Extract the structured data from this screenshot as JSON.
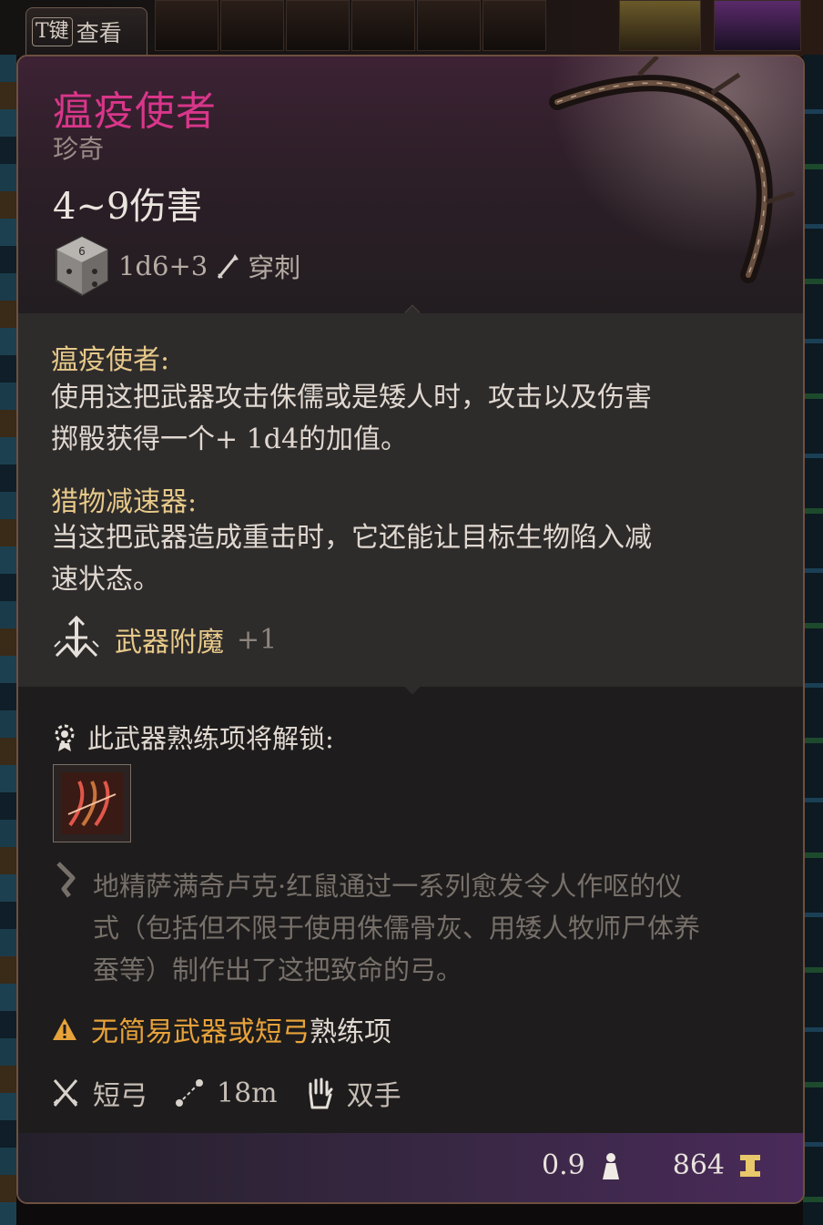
{
  "hotkey": {
    "key": "T键",
    "label": "查看"
  },
  "item": {
    "name": "瘟疫使者",
    "rarity": "珍奇",
    "damage": "4~9伤害",
    "dice": "1d6+3",
    "damage_type": "穿刺"
  },
  "passives": [
    {
      "title": "瘟疫使者:",
      "lines": [
        "使用这把武器攻击侏儒或是矮人时，攻击以及伤害",
        "掷骰获得一个+ 1d4的加值。"
      ]
    },
    {
      "title": "猎物减速器:",
      "lines": [
        "当这把武器造成重击时，它还能让目标生物陷入减",
        "速状态。"
      ]
    }
  ],
  "enchant": {
    "label": "武器附魔",
    "value": "+1"
  },
  "proficiency": {
    "label": "此武器熟练项将解锁:"
  },
  "lore": [
    "地精萨满奇卢克·红鼠通过一系列愈发令人作呕的仪",
    "式（包括但不限于使用侏儒骨灰、用矮人牧师尸体养",
    "蚕等）制作出了这把致命的弓。"
  ],
  "warning": {
    "highlight": "无简易武器或短弓",
    "rest": "熟练项"
  },
  "stats": {
    "weapon_type": "短弓",
    "range": "18m",
    "hands": "双手"
  },
  "footer": {
    "weight": "0.9",
    "value": "864"
  },
  "colors": {
    "name": "#d9368a",
    "title_gold": "#e7c989",
    "warning": "#e7a23a"
  },
  "icons": [
    "dice-icon",
    "pierce-icon",
    "enchant-icon",
    "gear-icon",
    "skill-icon",
    "lore-icon",
    "warning-icon",
    "crossed-swords-icon",
    "range-icon",
    "hand-icon",
    "weight-icon",
    "gold-icon"
  ]
}
